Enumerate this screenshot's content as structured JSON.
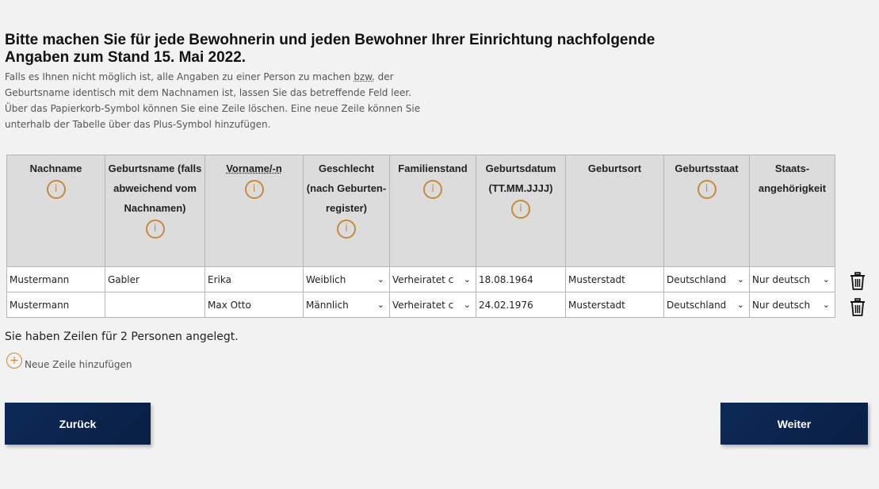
{
  "heading": "Bitte machen Sie für jede Bewohnerin und jeden Bewohner Ihrer Einrichtung nachfolgende Angaben zum Stand 15. Mai 2022.",
  "intro": {
    "line1_a": "Falls es Ihnen nicht möglich ist, alle Angaben zu einer Person zu machen ",
    "line1_u": "bzw.",
    "line1_b": " der Geburtsname identisch mit dem Nachnamen ist, lassen Sie das betreffende Feld leer.",
    "line2": " Über das Papierkorb-Symbol können Sie eine Zeile löschen. Eine neue Zeile können Sie unterhalb der Tabelle über das Plus-Symbol hinzufügen."
  },
  "columns": [
    {
      "label": "Nachname"
    },
    {
      "label": "Geburtsname (falls abweichend vom Nachnamen)"
    },
    {
      "label": "Vorname/-n"
    },
    {
      "label": "Geschlecht (nach Geburten-register)"
    },
    {
      "label": "Familienstand"
    },
    {
      "label": "Geburtsdatum (TT.MM.JJJJ)"
    },
    {
      "label": "Geburtsort"
    },
    {
      "label": "Geburtsstaat"
    },
    {
      "label": "Staats-angehörigkeit"
    }
  ],
  "info_glyph": "i",
  "rows": [
    {
      "nachname": "Mustermann",
      "geburtsname": "Gabler",
      "vorname": "Erika",
      "geschlecht": "Weiblich",
      "familienstand": "Verheiratet c",
      "geburtsdatum": "18.08.1964",
      "geburtsort": "Musterstadt",
      "geburtsstaat": "Deutschland",
      "staatsangehoerigkeit": "Nur deutsch"
    },
    {
      "nachname": "Mustermann",
      "geburtsname": "",
      "vorname": "Max Otto",
      "geschlecht": "Männlich",
      "familienstand": "Verheiratet c",
      "geburtsdatum": "24.02.1976",
      "geburtsort": "Musterstadt",
      "geburtsstaat": "Deutschland",
      "staatsangehoerigkeit": "Nur deutsch"
    }
  ],
  "row_count_text": "Sie haben Zeilen für 2 Personen angelegt.",
  "add_row_label": "Neue Zeile hinzufügen",
  "add_glyph": "+",
  "chevron_glyph": "⌄",
  "buttons": {
    "back": "Zurück",
    "next": "Weiter"
  },
  "colors": {
    "accent": "#c88a3a",
    "button": "#0c2a57",
    "header_bg": "#dcdcdc"
  }
}
